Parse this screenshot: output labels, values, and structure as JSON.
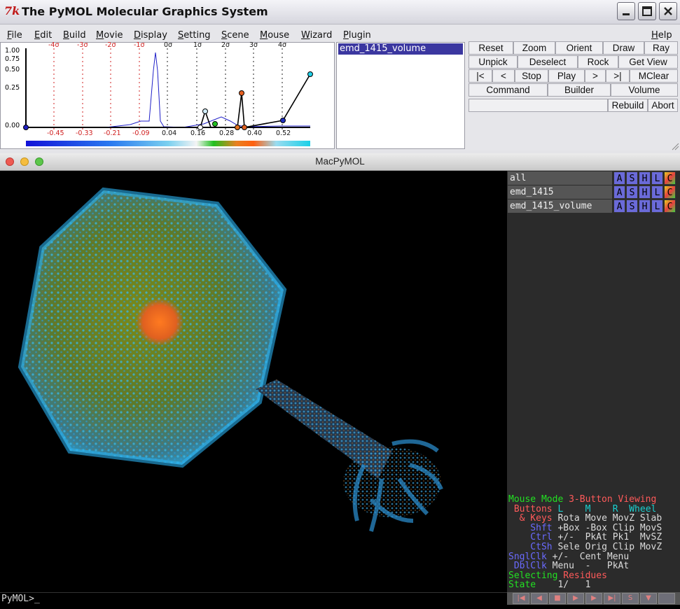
{
  "window": {
    "title": "The PyMOL Molecular Graphics System",
    "logo": "7k"
  },
  "menu": [
    "File",
    "Edit",
    "Build",
    "Movie",
    "Display",
    "Setting",
    "Scene",
    "Mouse",
    "Wizard",
    "Plugin",
    "Help"
  ],
  "volume_panel": {
    "y_ticks": [
      "1.00",
      "0.75",
      "0.50",
      "0.25",
      "0.00"
    ],
    "sigma_labels": [
      "-4σ",
      "-3σ",
      "-2σ",
      "-1σ",
      "0σ",
      "1σ",
      "2σ",
      "3σ",
      "4σ"
    ],
    "x_ticks": [
      "-0.45",
      "-0.33",
      "-0.21",
      "-0.09",
      "0.04",
      "0.16",
      "0.28",
      "0.40",
      "0.52"
    ]
  },
  "object_list": {
    "selected": "emd_1415_volume"
  },
  "buttons": {
    "row1": [
      "Reset",
      "Zoom",
      "Orient",
      "Draw",
      "Ray"
    ],
    "row2": [
      "Unpick",
      "Deselect",
      "Rock",
      "Get View"
    ],
    "row3": [
      "|<",
      "<",
      "Stop",
      "Play",
      ">",
      ">|",
      "MClear"
    ],
    "row4": [
      "Command",
      "Builder",
      "Volume"
    ],
    "row5": [
      "Rebuild",
      "Abort"
    ]
  },
  "viewer_window": {
    "title": "MacPyMOL"
  },
  "objects": [
    {
      "name": "all"
    },
    {
      "name": "emd_1415"
    },
    {
      "name": "emd_1415_volume"
    }
  ],
  "object_buttons": [
    "A",
    "S",
    "H",
    "L",
    "C"
  ],
  "mouse_help": {
    "line1": [
      "Mouse Mode ",
      "3-Button Viewing"
    ],
    "line2": [
      " Buttons ",
      "L    ",
      "M    ",
      "R  ",
      "Wheel"
    ],
    "line3": [
      "  & Keys ",
      "Rota Move MovZ Slab"
    ],
    "line4": [
      "    Shft ",
      "+Box -Box Clip MovS"
    ],
    "line5": [
      "    Ctrl ",
      "+/-  PkAt Pk1  MvSZ"
    ],
    "line6": [
      "    CtSh ",
      "Sele Orig Clip MovZ"
    ],
    "line7": [
      "SnglClk ",
      "+/-  Cent Menu"
    ],
    "line8": [
      " DblClk ",
      "Menu  -   PkAt"
    ],
    "line9": [
      "Selecting ",
      "Residues"
    ],
    "line10": [
      "State ",
      "   1/   1"
    ]
  },
  "command_line": {
    "prompt": "PyMOL>_"
  },
  "movie_controls": [
    "|◀",
    "◀",
    "■",
    "▶",
    "▶",
    "▶|",
    "S",
    "▼",
    ""
  ]
}
